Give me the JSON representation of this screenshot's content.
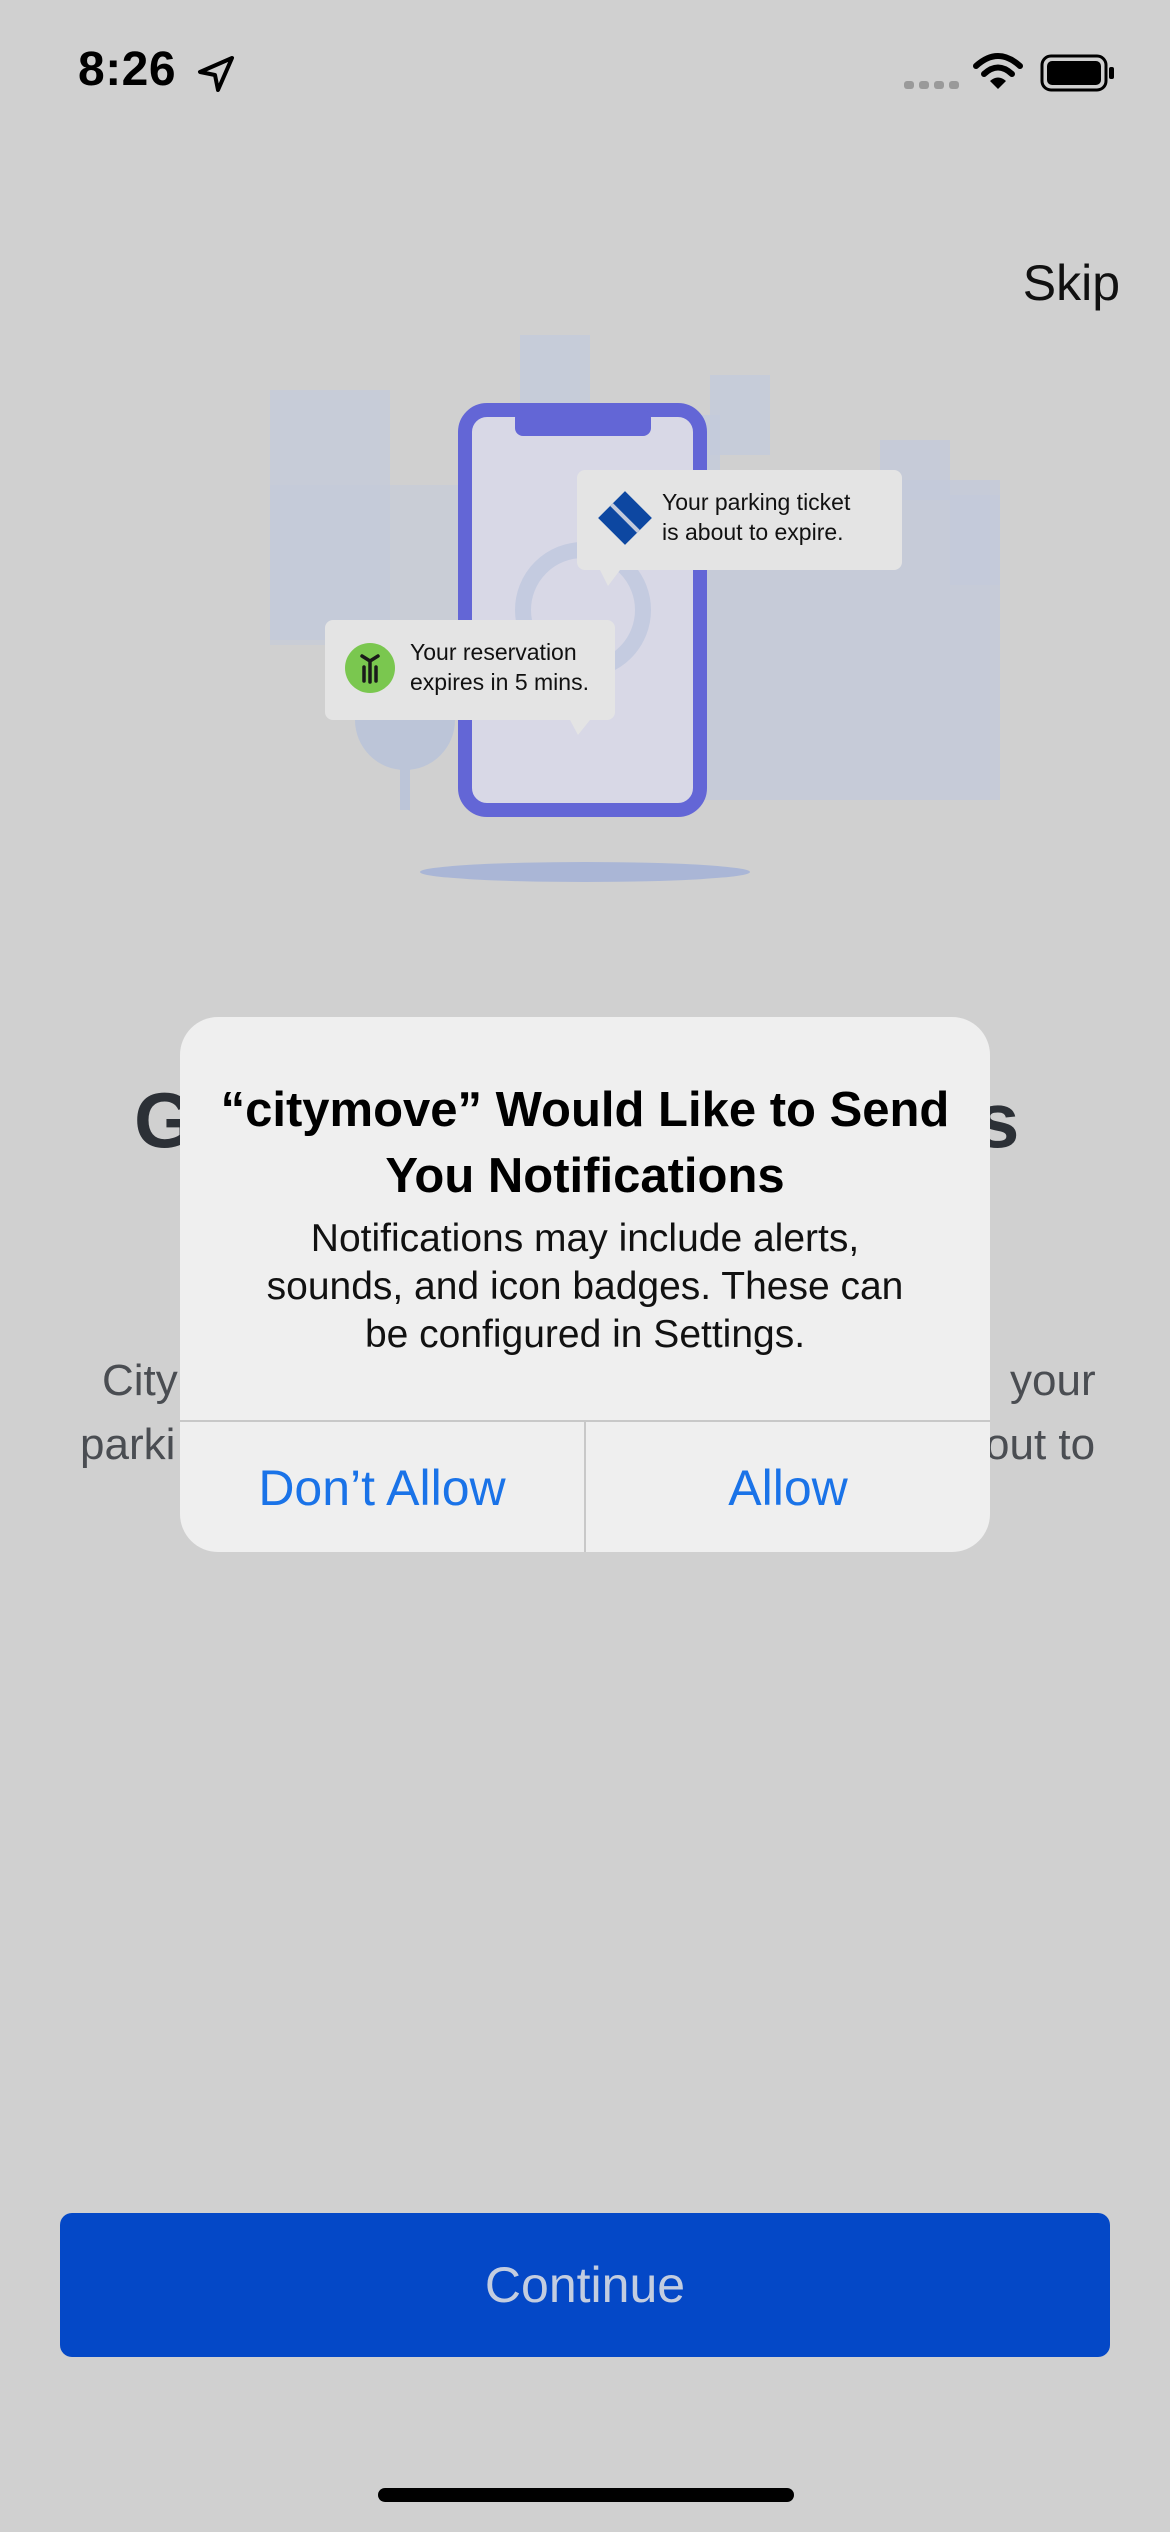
{
  "status_bar": {
    "time": "8:26",
    "icons": [
      "location-arrow-icon",
      "signal-icon",
      "wifi-icon",
      "battery-icon"
    ]
  },
  "header": {
    "skip_label": "Skip"
  },
  "illustration": {
    "notification_1": "Your parking ticket is about to expire.",
    "notification_2": "Your reservation expires in 5 mins.",
    "colors": {
      "phone": "#6366d6",
      "buildings": "#c3cadb",
      "ticket_icon": "#0d47a1",
      "scooter_icon": "#7ac74f"
    }
  },
  "background_content": {
    "heading_left_fragment": "G",
    "heading_right_fragment": "s",
    "body_line1_left": "City",
    "body_line1_right": "your",
    "body_line2_left": "parki",
    "body_line2_right": "out to"
  },
  "alert": {
    "title": "“citymove” Would Like to Send You Notifications",
    "message": "Notifications may include alerts, sounds, and icon badges. These can be configured in Settings.",
    "deny_label": "Don’t Allow",
    "allow_label": "Allow",
    "button_color": "#1a73e8"
  },
  "footer": {
    "continue_label": "Continue",
    "accent": "#0448c7"
  }
}
